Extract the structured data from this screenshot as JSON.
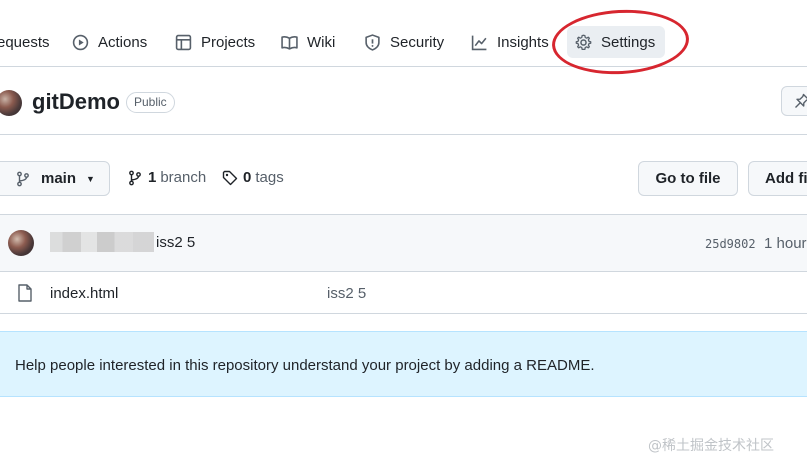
{
  "nav": {
    "items": [
      {
        "label": "equests",
        "icon": "pull-request-icon"
      },
      {
        "label": "Actions",
        "icon": "play-circle-icon"
      },
      {
        "label": "Projects",
        "icon": "table-icon"
      },
      {
        "label": "Wiki",
        "icon": "book-icon"
      },
      {
        "label": "Security",
        "icon": "shield-icon"
      },
      {
        "label": "Insights",
        "icon": "graph-icon"
      },
      {
        "label": "Settings",
        "icon": "gear-icon",
        "selected": true
      }
    ],
    "highlight_color": "#d7262f"
  },
  "repo": {
    "name": "gitDemo",
    "visibility": "Public"
  },
  "branch_bar": {
    "current_branch": "main",
    "branch_count": "1",
    "branch_label": "branch",
    "tag_count": "0",
    "tag_label": "tags",
    "goto_file_label": "Go to file",
    "add_file_label": "Add fi"
  },
  "latest_commit": {
    "message": "iss2 5",
    "sha": "25d9802",
    "time": "1 hour"
  },
  "files": [
    {
      "name": "index.html",
      "commit_message": "iss2 5"
    }
  ],
  "readme_banner": {
    "text": "Help people interested in this repository understand your project by adding a README."
  },
  "watermark": "@稀土掘金技术社区"
}
